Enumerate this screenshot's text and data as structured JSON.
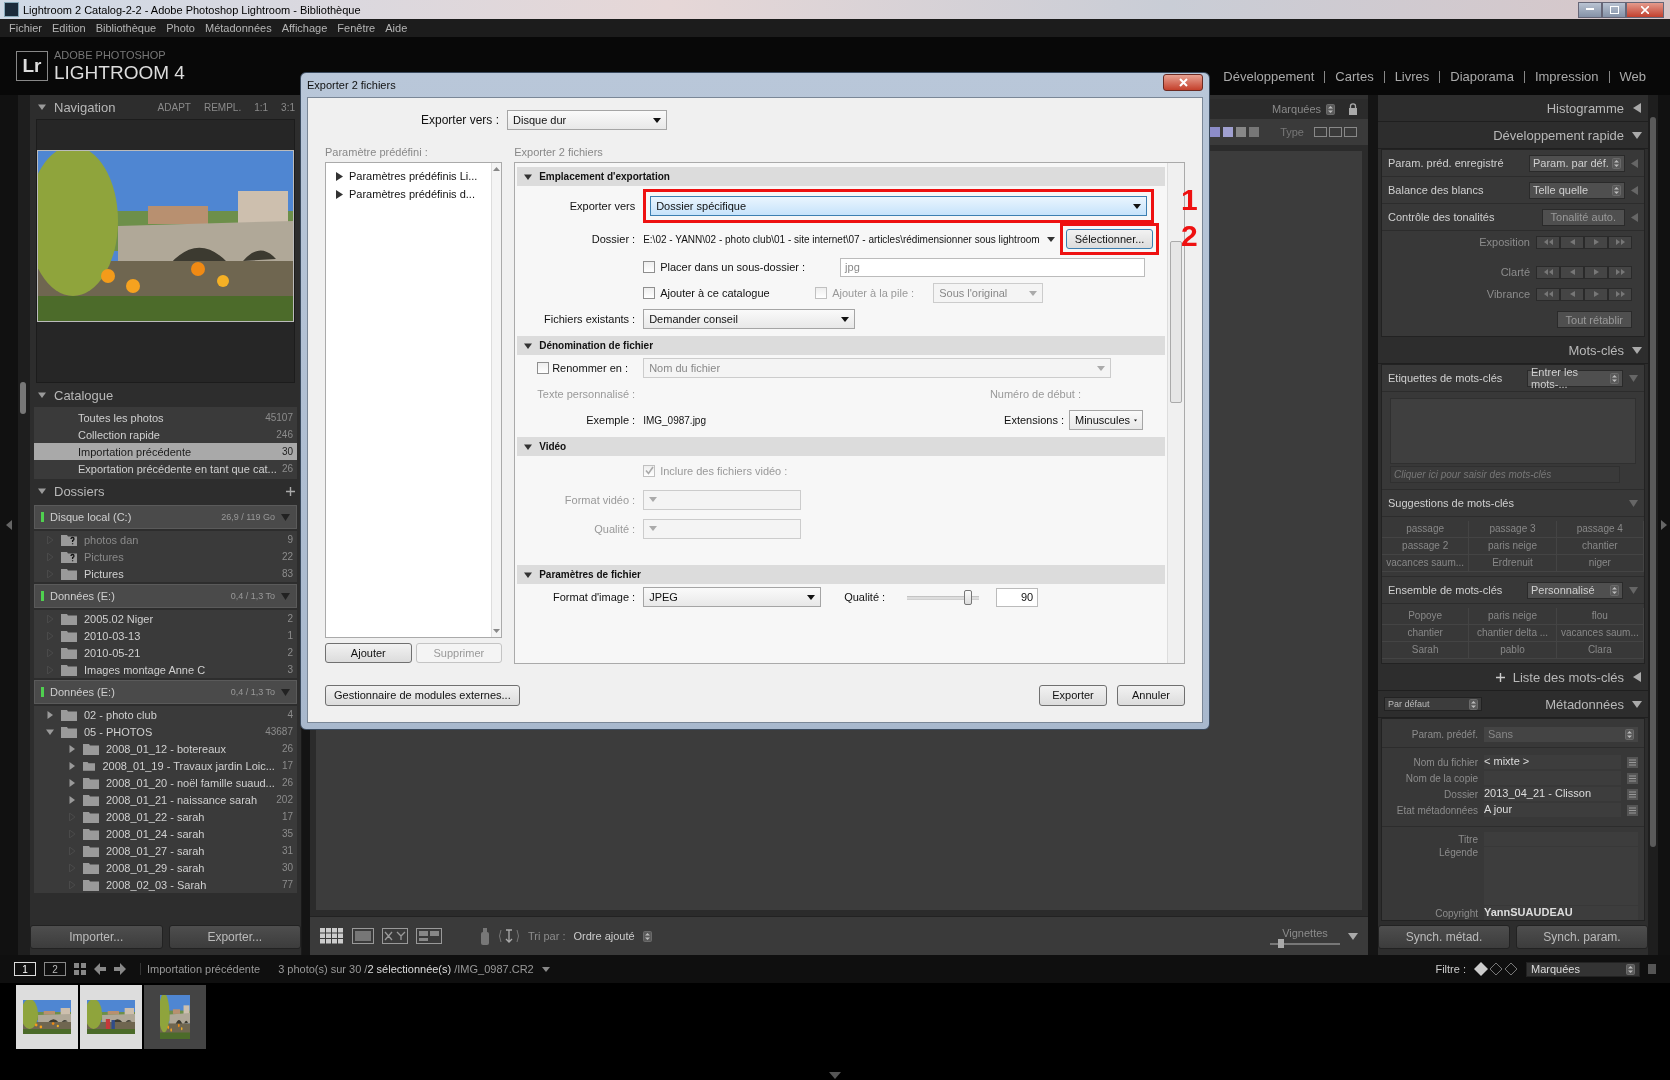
{
  "window": {
    "title": "Lightroom 2 Catalog-2-2 - Adobe Photoshop Lightroom - Bibliothèque"
  },
  "menu": [
    "Fichier",
    "Edition",
    "Bibliothèque",
    "Photo",
    "Métadonnées",
    "Affichage",
    "Fenêtre",
    "Aide"
  ],
  "identity": {
    "badge": "Lr",
    "vendor": "ADOBE PHOTOSHOP",
    "product": "LIGHTROOM 4"
  },
  "modules": [
    "Développement",
    "Cartes",
    "Livres",
    "Diaporama",
    "Impression",
    "Web"
  ],
  "left_panel": {
    "navigator": {
      "title": "Navigation",
      "expanded": true,
      "zoom_options": [
        "ADAPT",
        "REMPL.",
        "1:1",
        "3:1"
      ]
    },
    "catalog": {
      "title": "Catalogue",
      "expanded": true,
      "items": [
        {
          "label": "Toutes les photos",
          "count": "45107",
          "selected": false
        },
        {
          "label": "Collection rapide",
          "count": "246",
          "selected": false
        },
        {
          "label": "Importation précédente",
          "count": "30",
          "selected": true
        },
        {
          "label": "Exportation précédente en tant que cat...",
          "count": "26",
          "selected": false
        }
      ]
    },
    "folders": {
      "title": "Dossiers",
      "expanded": true,
      "volumes": [
        {
          "name": "Disque local (C:)",
          "space": "26,9 / 119 Go",
          "folders": [
            {
              "name": "photos dan",
              "count": "9",
              "missing": true
            },
            {
              "name": "Pictures",
              "count": "22",
              "missing": true
            },
            {
              "name": "Pictures",
              "count": "83"
            }
          ]
        },
        {
          "name": "Données (E:)",
          "space": "0,4 / 1,3 To",
          "folders": [
            {
              "name": "2005.02 Niger",
              "count": "2"
            },
            {
              "name": "2010-03-13",
              "count": "1"
            },
            {
              "name": "2010-05-21",
              "count": "2"
            },
            {
              "name": "Images montage Anne C",
              "count": "3"
            }
          ]
        },
        {
          "name": "Données (E:)",
          "space": "0,4 / 1,3 To",
          "folders": [
            {
              "name": "02 - photo club",
              "count": "4",
              "expanded": false
            },
            {
              "name": "05 - PHOTOS",
              "count": "43687",
              "expanded": true,
              "children": [
                {
                  "name": "2008_01_12 - botereaux",
                  "count": "26",
                  "expanded": false
                },
                {
                  "name": "2008_01_19 - Travaux jardin Loic...",
                  "count": "17",
                  "expanded": false
                },
                {
                  "name": "2008_01_20 - noël famille suaud...",
                  "count": "26",
                  "expanded": false
                },
                {
                  "name": "2008_01_21 - naissance sarah",
                  "count": "202",
                  "expanded": false
                },
                {
                  "name": "2008_01_22 - sarah",
                  "count": "17"
                },
                {
                  "name": "2008_01_24 - sarah",
                  "count": "35"
                },
                {
                  "name": "2008_01_27 - sarah",
                  "count": "31"
                },
                {
                  "name": "2008_01_29 - sarah",
                  "count": "30"
                },
                {
                  "name": "2008_02_03 - Sarah",
                  "count": "77"
                }
              ]
            }
          ]
        }
      ]
    },
    "buttons": [
      "Importer...",
      "Exporter..."
    ]
  },
  "center": {
    "filter_preset": "Marquées",
    "type_label": "Type",
    "sort_label": "Tri par :",
    "sort": "Ordre ajouté",
    "thumbnails_label": "Vignettes",
    "thumbnail_size": {
      "level": 0.15
    }
  },
  "right_panel": {
    "histogram": {
      "title": "Histogramme",
      "expanded": false
    },
    "quick_develop": {
      "title": "Développement rapide",
      "expanded": true,
      "rows": [
        {
          "label": "Param. préd. enregistré",
          "value": "Param. par déf.",
          "kind": "select"
        },
        {
          "label": "Balance des blancs",
          "value": "Telle quelle",
          "kind": "select"
        },
        {
          "label": "Contrôle des tonalités",
          "value": "Tonalité auto.",
          "kind": "button"
        }
      ],
      "adjustments": [
        "Exposition",
        "Clarté",
        "Vibrance"
      ],
      "reset": "Tout rétablir"
    },
    "keywording": {
      "title": "Mots-clés",
      "expanded": true,
      "tags_label": "Etiquettes de mots-clés",
      "tags_mode": "Entrer les mots-...",
      "placeholder": "Cliquer ici pour saisir des mots-clés",
      "suggestions_title": "Suggestions de mots-clés",
      "suggestions": [
        "passage",
        "passage 3",
        "passage 4",
        "passage 2",
        "paris neige",
        "chantier",
        "vacances saum...",
        "Erdrenuit",
        "niger"
      ],
      "set_label": "Ensemble de mots-clés",
      "set": "Personnalisé",
      "set_keywords": [
        "Popoye",
        "paris neige",
        "flou",
        "chantier",
        "chantier delta ...",
        "vacances saum...",
        "Sarah",
        "pablo",
        "Clara"
      ]
    },
    "keyword_list": {
      "title": "Liste des mots-clés",
      "expanded": false
    },
    "metadata": {
      "title": "Métadonnées",
      "expanded": true,
      "view": "Par défaut",
      "preset_label": "Param. prédéf.",
      "preset": "Sans",
      "fields": [
        {
          "label": "Nom du fichier",
          "value": "< mixte >"
        },
        {
          "label": "Nom de la copie"
        },
        {
          "label": "Dossier",
          "value": "2013_04_21 - Clisson"
        },
        {
          "label": "Etat métadonnées",
          "value": "A jour"
        }
      ],
      "iptc_fields": [
        {
          "label": "Titre",
          "kind": "line"
        },
        {
          "label": "Légende",
          "kind": "area"
        },
        {
          "label": "Copyright",
          "value": "YannSUAUDEAU",
          "kind": "line"
        }
      ]
    },
    "buttons": [
      "Synch. métad.",
      "Synch. param."
    ]
  },
  "filmstrip": {
    "screens": [
      {
        "label": "1",
        "selected": true
      },
      {
        "label": "2",
        "selected": false
      }
    ],
    "source": "Importation précédente",
    "info": "3 photo(s) sur 30 /**2 sélectionnée(s)** /IMG_0987.CR2",
    "filter_label": "Filtre :",
    "filter": "Marquées",
    "thumbnails": [
      {
        "selected": true
      },
      {
        "selected": true
      },
      {
        "selected": false
      }
    ]
  },
  "dialog": {
    "title": "Exporter 2 fichiers",
    "export_to_label": "Exporter vers :",
    "export_to": "Disque dur",
    "presets_label": "Paramètre prédéfini :",
    "presets": [
      "Paramètres prédéfinis Li...",
      "Paramètres prédéfinis d..."
    ],
    "preset_buttons": [
      {
        "label": "Ajouter",
        "disabled": false
      },
      {
        "label": "Supprimer",
        "disabled": true
      }
    ],
    "settings_caption": "Exporter 2 fichiers",
    "location": {
      "title": "Emplacement d'exportation",
      "expanded": true,
      "export_to_label": "Exporter vers",
      "export_to": "Dossier spécifique",
      "folder_label": "Dossier :",
      "folder_path": "E:\\02 - YANN\\02 - photo club\\01 - site internet\\07 - articles\\rédimensionner sous lightroom",
      "choose_button": "Sélectionner...",
      "subfolder": {
        "label": "Placer dans un sous-dossier :",
        "checked": false,
        "value": "jpg"
      },
      "add_to_catalog": {
        "label": "Ajouter à ce catalogue",
        "checked": false
      },
      "add_to_stack": {
        "label": "Ajouter à la pile :",
        "checked": false,
        "disabled": true,
        "value": "Sous l'original"
      },
      "existing_label": "Fichiers existants :",
      "existing": "Demander conseil"
    },
    "naming": {
      "title": "Dénomination de fichier",
      "expanded": true,
      "rename": {
        "label": "Renommer en :",
        "checked": false,
        "value": "Nom du fichier"
      },
      "custom_text_label": "Texte personnalisé :",
      "start_number_label": "Numéro de début :",
      "example_label": "Exemple :",
      "example": "IMG_0987.jpg",
      "extensions_label": "Extensions :",
      "extensions": "Minuscules"
    },
    "video": {
      "title": "Vidéo",
      "expanded": true,
      "include": {
        "label": "Inclure des fichiers vidéo :",
        "checked": true,
        "disabled": true
      },
      "format_label": "Format vidéo :",
      "quality_label": "Qualité :"
    },
    "file_settings": {
      "title": "Paramètres de fichier",
      "expanded": true,
      "format_label": "Format d'image :",
      "format": "JPEG",
      "quality_label": "Qualité :",
      "quality": {
        "level": 0.85
      },
      "quality_value": "90"
    },
    "annotations": [
      {
        "label": "1"
      },
      {
        "label": "2"
      }
    ],
    "footer_buttons": [
      "Gestionnaire de modules externes...",
      "Exporter",
      "Annuler"
    ]
  }
}
